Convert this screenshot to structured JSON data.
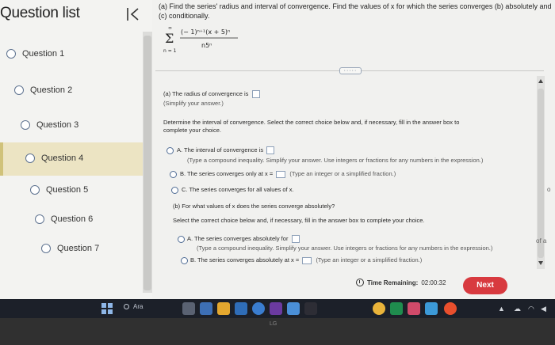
{
  "sidebar": {
    "title": "Question list",
    "questions": [
      {
        "label": "Question 1"
      },
      {
        "label": "Question 2"
      },
      {
        "label": "Question 3"
      },
      {
        "label": "Question 4",
        "active": true
      },
      {
        "label": "Question 5"
      },
      {
        "label": "Question 6"
      },
      {
        "label": "Question 7"
      }
    ]
  },
  "problem": {
    "intro_line1": "(a) Find the series' radius and interval of convergence. Find the values of x for which the series converges (b) absolutely and",
    "intro_line2": "(c) conditionally.",
    "formula": {
      "sum_upper": "∞",
      "sum_lower": "n = 1",
      "numerator": "(− 1)ⁿ⁺¹(x + 5)ⁿ",
      "denominator": "n5ⁿ"
    },
    "more_label": "·····"
  },
  "part_a": {
    "radius_prompt": "(a) The radius of convergence is",
    "radius_note": "(Simplify your answer.)",
    "interval_instr_line1": "Determine the interval of convergence. Select the correct choice below and, if necessary, fill in the answer box to",
    "interval_instr_line2": "complete your choice.",
    "options": [
      {
        "letter": "A.",
        "text": "The interval of convergence is",
        "note": "(Type a compound inequality. Simplify your answer. Use integers or fractions for any numbers in the expression.)"
      },
      {
        "letter": "B.",
        "text": "The series converges only at x =",
        "note": "(Type an integer or a simplified fraction.)"
      },
      {
        "letter": "C.",
        "text": "The series converges for all values of x."
      }
    ]
  },
  "part_b": {
    "prompt": "(b) For what values of x does the series converge absolutely?",
    "instr": "Select the correct choice below and, if necessary, fill in the answer box to complete your choice.",
    "options": [
      {
        "letter": "A.",
        "text": "The series converges absolutely for",
        "note": "(Type a compound inequality. Simplify your answer. Use integers or fractions for any numbers in the expression.)"
      },
      {
        "letter": "B.",
        "text": "The series converges absolutely at x =",
        "note": "(Type an integer or a simplified fraction.)"
      }
    ]
  },
  "edge_text": {
    "right_o": "o",
    "right_of": "of a"
  },
  "footer": {
    "timer_label": "Time Remaining:",
    "timer_value": "02:00:32",
    "next_label": "Next"
  },
  "taskbar": {
    "search_label": "Ara"
  },
  "bezel": {
    "logo": "LG"
  },
  "colors": {
    "next_button": "#d83a3f",
    "active_question_bg": "#ece4c3",
    "radio_border": "#4e6b94"
  }
}
